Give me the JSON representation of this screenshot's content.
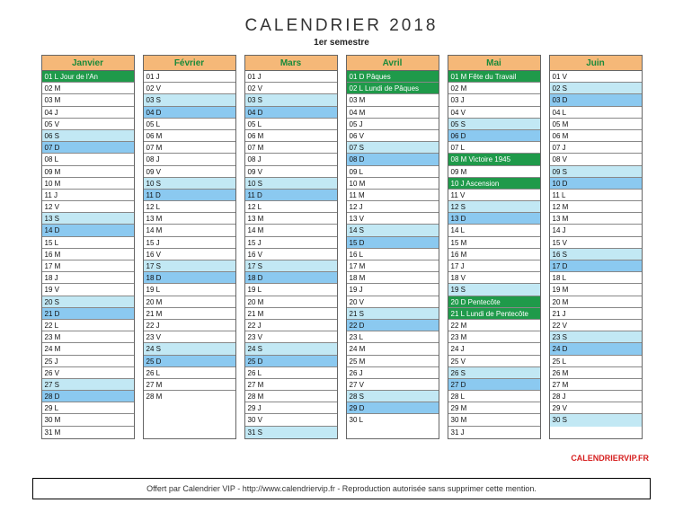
{
  "title": "CALENDRIER 2018",
  "subtitle": "1er semestre",
  "credit": "CALENDRIERVIP.FR",
  "footer": "Offert par Calendrier VIP - http://www.calendriervip.fr - Reproduction autorisée sans supprimer cette mention.",
  "months": [
    {
      "name": "Janvier",
      "days": [
        {
          "t": "01 L Jour de l'An",
          "c": "hol"
        },
        {
          "t": "02 M",
          "c": ""
        },
        {
          "t": "03 M",
          "c": ""
        },
        {
          "t": "04 J",
          "c": ""
        },
        {
          "t": "05 V",
          "c": ""
        },
        {
          "t": "06 S",
          "c": "sat"
        },
        {
          "t": "07 D",
          "c": "sun"
        },
        {
          "t": "08 L",
          "c": ""
        },
        {
          "t": "09 M",
          "c": ""
        },
        {
          "t": "10 M",
          "c": ""
        },
        {
          "t": "11 J",
          "c": ""
        },
        {
          "t": "12 V",
          "c": ""
        },
        {
          "t": "13 S",
          "c": "sat"
        },
        {
          "t": "14 D",
          "c": "sun"
        },
        {
          "t": "15 L",
          "c": ""
        },
        {
          "t": "16 M",
          "c": ""
        },
        {
          "t": "17 M",
          "c": ""
        },
        {
          "t": "18 J",
          "c": ""
        },
        {
          "t": "19 V",
          "c": ""
        },
        {
          "t": "20 S",
          "c": "sat"
        },
        {
          "t": "21 D",
          "c": "sun"
        },
        {
          "t": "22 L",
          "c": ""
        },
        {
          "t": "23 M",
          "c": ""
        },
        {
          "t": "24 M",
          "c": ""
        },
        {
          "t": "25 J",
          "c": ""
        },
        {
          "t": "26 V",
          "c": ""
        },
        {
          "t": "27 S",
          "c": "sat"
        },
        {
          "t": "28 D",
          "c": "sun"
        },
        {
          "t": "29 L",
          "c": ""
        },
        {
          "t": "30 M",
          "c": ""
        },
        {
          "t": "31 M",
          "c": ""
        }
      ]
    },
    {
      "name": "Février",
      "days": [
        {
          "t": "01 J",
          "c": ""
        },
        {
          "t": "02 V",
          "c": ""
        },
        {
          "t": "03 S",
          "c": "sat"
        },
        {
          "t": "04 D",
          "c": "sun"
        },
        {
          "t": "05 L",
          "c": ""
        },
        {
          "t": "06 M",
          "c": ""
        },
        {
          "t": "07 M",
          "c": ""
        },
        {
          "t": "08 J",
          "c": ""
        },
        {
          "t": "09 V",
          "c": ""
        },
        {
          "t": "10 S",
          "c": "sat"
        },
        {
          "t": "11 D",
          "c": "sun"
        },
        {
          "t": "12 L",
          "c": ""
        },
        {
          "t": "13 M",
          "c": ""
        },
        {
          "t": "14 M",
          "c": ""
        },
        {
          "t": "15 J",
          "c": ""
        },
        {
          "t": "16 V",
          "c": ""
        },
        {
          "t": "17 S",
          "c": "sat"
        },
        {
          "t": "18 D",
          "c": "sun"
        },
        {
          "t": "19 L",
          "c": ""
        },
        {
          "t": "20 M",
          "c": ""
        },
        {
          "t": "21 M",
          "c": ""
        },
        {
          "t": "22 J",
          "c": ""
        },
        {
          "t": "23 V",
          "c": ""
        },
        {
          "t": "24 S",
          "c": "sat"
        },
        {
          "t": "25 D",
          "c": "sun"
        },
        {
          "t": "26 L",
          "c": ""
        },
        {
          "t": "27 M",
          "c": ""
        },
        {
          "t": "28 M",
          "c": ""
        }
      ]
    },
    {
      "name": "Mars",
      "days": [
        {
          "t": "01 J",
          "c": ""
        },
        {
          "t": "02 V",
          "c": ""
        },
        {
          "t": "03 S",
          "c": "sat"
        },
        {
          "t": "04 D",
          "c": "sun"
        },
        {
          "t": "05 L",
          "c": ""
        },
        {
          "t": "06 M",
          "c": ""
        },
        {
          "t": "07 M",
          "c": ""
        },
        {
          "t": "08 J",
          "c": ""
        },
        {
          "t": "09 V",
          "c": ""
        },
        {
          "t": "10 S",
          "c": "sat"
        },
        {
          "t": "11 D",
          "c": "sun"
        },
        {
          "t": "12 L",
          "c": ""
        },
        {
          "t": "13 M",
          "c": ""
        },
        {
          "t": "14 M",
          "c": ""
        },
        {
          "t": "15 J",
          "c": ""
        },
        {
          "t": "16 V",
          "c": ""
        },
        {
          "t": "17 S",
          "c": "sat"
        },
        {
          "t": "18 D",
          "c": "sun"
        },
        {
          "t": "19 L",
          "c": ""
        },
        {
          "t": "20 M",
          "c": ""
        },
        {
          "t": "21 M",
          "c": ""
        },
        {
          "t": "22 J",
          "c": ""
        },
        {
          "t": "23 V",
          "c": ""
        },
        {
          "t": "24 S",
          "c": "sat"
        },
        {
          "t": "25 D",
          "c": "sun"
        },
        {
          "t": "26 L",
          "c": ""
        },
        {
          "t": "27 M",
          "c": ""
        },
        {
          "t": "28 M",
          "c": ""
        },
        {
          "t": "29 J",
          "c": ""
        },
        {
          "t": "30 V",
          "c": ""
        },
        {
          "t": "31 S",
          "c": "sat"
        }
      ]
    },
    {
      "name": "Avril",
      "days": [
        {
          "t": "01 D Pâques",
          "c": "hol"
        },
        {
          "t": "02 L Lundi de Pâques",
          "c": "hol"
        },
        {
          "t": "03 M",
          "c": ""
        },
        {
          "t": "04 M",
          "c": ""
        },
        {
          "t": "05 J",
          "c": ""
        },
        {
          "t": "06 V",
          "c": ""
        },
        {
          "t": "07 S",
          "c": "sat"
        },
        {
          "t": "08 D",
          "c": "sun"
        },
        {
          "t": "09 L",
          "c": ""
        },
        {
          "t": "10 M",
          "c": ""
        },
        {
          "t": "11 M",
          "c": ""
        },
        {
          "t": "12 J",
          "c": ""
        },
        {
          "t": "13 V",
          "c": ""
        },
        {
          "t": "14 S",
          "c": "sat"
        },
        {
          "t": "15 D",
          "c": "sun"
        },
        {
          "t": "16 L",
          "c": ""
        },
        {
          "t": "17 M",
          "c": ""
        },
        {
          "t": "18 M",
          "c": ""
        },
        {
          "t": "19 J",
          "c": ""
        },
        {
          "t": "20 V",
          "c": ""
        },
        {
          "t": "21 S",
          "c": "sat"
        },
        {
          "t": "22 D",
          "c": "sun"
        },
        {
          "t": "23 L",
          "c": ""
        },
        {
          "t": "24 M",
          "c": ""
        },
        {
          "t": "25 M",
          "c": ""
        },
        {
          "t": "26 J",
          "c": ""
        },
        {
          "t": "27 V",
          "c": ""
        },
        {
          "t": "28 S",
          "c": "sat"
        },
        {
          "t": "29 D",
          "c": "sun"
        },
        {
          "t": "30 L",
          "c": ""
        }
      ]
    },
    {
      "name": "Mai",
      "days": [
        {
          "t": "01 M Fête du Travail",
          "c": "hol"
        },
        {
          "t": "02 M",
          "c": ""
        },
        {
          "t": "03 J",
          "c": ""
        },
        {
          "t": "04 V",
          "c": ""
        },
        {
          "t": "05 S",
          "c": "sat"
        },
        {
          "t": "06 D",
          "c": "sun"
        },
        {
          "t": "07 L",
          "c": ""
        },
        {
          "t": "08 M Victoire 1945",
          "c": "hol"
        },
        {
          "t": "09 M",
          "c": ""
        },
        {
          "t": "10 J Ascension",
          "c": "hol"
        },
        {
          "t": "11 V",
          "c": ""
        },
        {
          "t": "12 S",
          "c": "sat"
        },
        {
          "t": "13 D",
          "c": "sun"
        },
        {
          "t": "14 L",
          "c": ""
        },
        {
          "t": "15 M",
          "c": ""
        },
        {
          "t": "16 M",
          "c": ""
        },
        {
          "t": "17 J",
          "c": ""
        },
        {
          "t": "18 V",
          "c": ""
        },
        {
          "t": "19 S",
          "c": "sat"
        },
        {
          "t": "20 D Pentecôte",
          "c": "hol"
        },
        {
          "t": "21 L Lundi de Pentecôte",
          "c": "hol"
        },
        {
          "t": "22 M",
          "c": ""
        },
        {
          "t": "23 M",
          "c": ""
        },
        {
          "t": "24 J",
          "c": ""
        },
        {
          "t": "25 V",
          "c": ""
        },
        {
          "t": "26 S",
          "c": "sat"
        },
        {
          "t": "27 D",
          "c": "sun"
        },
        {
          "t": "28 L",
          "c": ""
        },
        {
          "t": "29 M",
          "c": ""
        },
        {
          "t": "30 M",
          "c": ""
        },
        {
          "t": "31 J",
          "c": ""
        }
      ]
    },
    {
      "name": "Juin",
      "days": [
        {
          "t": "01 V",
          "c": ""
        },
        {
          "t": "02 S",
          "c": "sat"
        },
        {
          "t": "03 D",
          "c": "sun"
        },
        {
          "t": "04 L",
          "c": ""
        },
        {
          "t": "05 M",
          "c": ""
        },
        {
          "t": "06 M",
          "c": ""
        },
        {
          "t": "07 J",
          "c": ""
        },
        {
          "t": "08 V",
          "c": ""
        },
        {
          "t": "09 S",
          "c": "sat"
        },
        {
          "t": "10 D",
          "c": "sun"
        },
        {
          "t": "11 L",
          "c": ""
        },
        {
          "t": "12 M",
          "c": ""
        },
        {
          "t": "13 M",
          "c": ""
        },
        {
          "t": "14 J",
          "c": ""
        },
        {
          "t": "15 V",
          "c": ""
        },
        {
          "t": "16 S",
          "c": "sat"
        },
        {
          "t": "17 D",
          "c": "sun"
        },
        {
          "t": "18 L",
          "c": ""
        },
        {
          "t": "19 M",
          "c": ""
        },
        {
          "t": "20 M",
          "c": ""
        },
        {
          "t": "21 J",
          "c": ""
        },
        {
          "t": "22 V",
          "c": ""
        },
        {
          "t": "23 S",
          "c": "sat"
        },
        {
          "t": "24 D",
          "c": "sun"
        },
        {
          "t": "25 L",
          "c": ""
        },
        {
          "t": "26 M",
          "c": ""
        },
        {
          "t": "27 M",
          "c": ""
        },
        {
          "t": "28 J",
          "c": ""
        },
        {
          "t": "29 V",
          "c": ""
        },
        {
          "t": "30 S",
          "c": "sat"
        }
      ]
    }
  ]
}
